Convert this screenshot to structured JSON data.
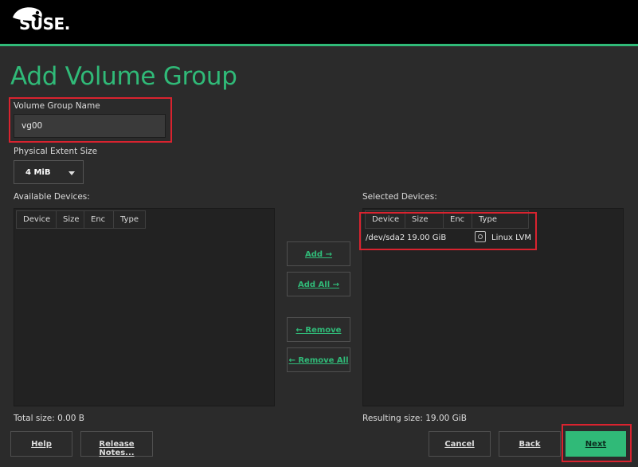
{
  "brand": {
    "name": "SUSE.",
    "accent_color": "#30ba78"
  },
  "page": {
    "title": "Add Volume Group"
  },
  "vg_name": {
    "label": "Volume Group Name",
    "value": "vg00"
  },
  "extent": {
    "label": "Physical Extent Size",
    "value": "4 MiB"
  },
  "available": {
    "label": "Available Devices:",
    "columns": [
      "Device",
      "Size",
      "Enc",
      "Type"
    ],
    "rows": [],
    "total": "Total size: 0.00 B"
  },
  "selected": {
    "label": "Selected Devices:",
    "columns": [
      "Device",
      "Size",
      "Enc",
      "Type"
    ],
    "rows": [
      {
        "device": "/dev/sda2",
        "size": "19.00 GiB",
        "enc": "",
        "type": "Linux LVM",
        "icon": "disk-icon"
      }
    ],
    "total": "Resulting size: 19.00 GiB"
  },
  "actions": {
    "add": "Add →",
    "add_all": "Add All →",
    "remove": "← Remove",
    "remove_all": "← Remove All"
  },
  "footer": {
    "help": "Help",
    "release_notes": "Release Notes...",
    "cancel": "Cancel",
    "back": "Back",
    "next": "Next"
  }
}
